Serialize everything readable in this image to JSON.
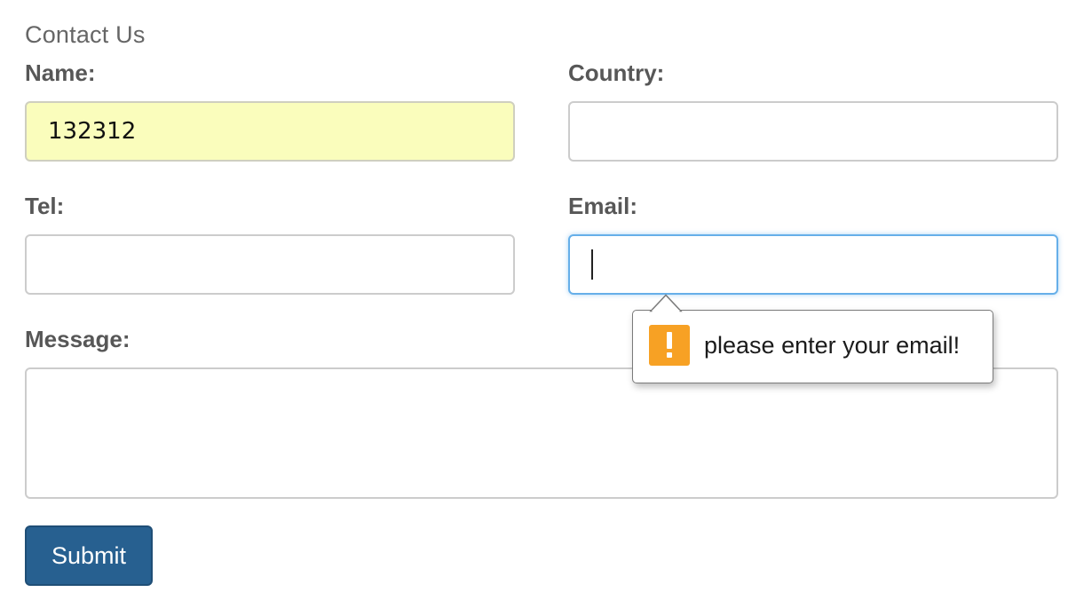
{
  "form": {
    "title": "Contact Us",
    "fields": {
      "name": {
        "label": "Name:",
        "value": "132312"
      },
      "country": {
        "label": "Country:",
        "value": ""
      },
      "tel": {
        "label": "Tel:",
        "value": ""
      },
      "email": {
        "label": "Email:",
        "value": ""
      },
      "message": {
        "label": "Message:",
        "value": ""
      }
    },
    "submit_label": "Submit"
  },
  "validation_tooltip": {
    "icon": "warning-icon",
    "message": "please enter your email!"
  },
  "colors": {
    "autofill_background": "#fafdbc",
    "focus_border": "#66afe9",
    "submit_button": "#276090",
    "warning_icon": "#f7a124"
  }
}
